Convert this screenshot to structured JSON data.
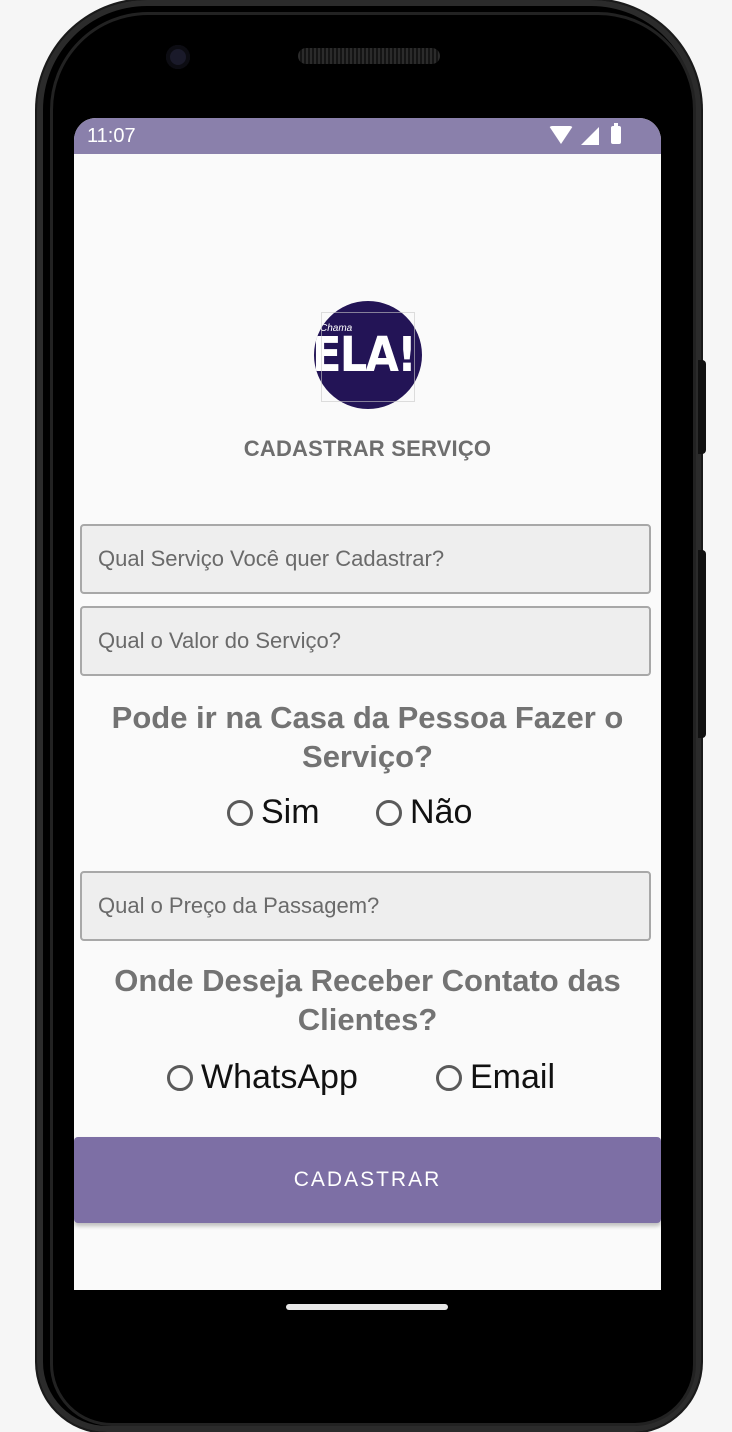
{
  "status_bar": {
    "time": "11:07",
    "icons": [
      "wifi-icon",
      "signal-icon",
      "battery-icon"
    ],
    "background": "#8a80ab"
  },
  "logo": {
    "small_text": "Chama",
    "main_text": "ELA!",
    "background": "#231456"
  },
  "page": {
    "title": "CADASTRAR SERVIÇO"
  },
  "form": {
    "service_placeholder": "Qual Serviço Você quer Cadastrar?",
    "value_placeholder": "Qual o Valor do Serviço?",
    "home_visit_question": "Pode ir na Casa da Pessoa Fazer o Serviço?",
    "home_visit_options": [
      "Sim",
      "Não"
    ],
    "fare_placeholder": "Qual o Preço da Passagem?",
    "contact_question": "Onde Deseja Receber Contato das Clientes?",
    "contact_options": [
      "WhatsApp",
      "Email"
    ],
    "submit_label": "CADASTRAR"
  },
  "colors": {
    "accent": "#7d6fa5",
    "question_text": "#737373"
  }
}
